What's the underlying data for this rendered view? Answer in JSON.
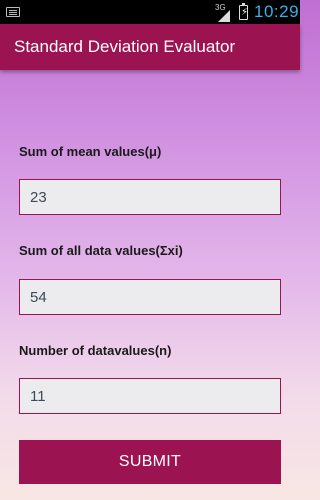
{
  "status_bar": {
    "network_type": "3G",
    "time": "10:29",
    "icons": [
      "notification-icon",
      "signal-icon",
      "battery-charging-icon"
    ]
  },
  "app_bar": {
    "title": "Standard Deviation Evaluator"
  },
  "form": {
    "fields": [
      {
        "label": "Sum of mean values(μ)",
        "value": "23"
      },
      {
        "label": "Sum of all data values(Σxi)",
        "value": "54"
      },
      {
        "label": "Number of datavalues(n)",
        "value": "11"
      }
    ],
    "submit_label": "SUBMIT"
  },
  "colors": {
    "primary": "#9b1350",
    "background_top": "#c06fd2",
    "background_bottom": "#f8e6e4",
    "clock": "#39b0e8"
  }
}
